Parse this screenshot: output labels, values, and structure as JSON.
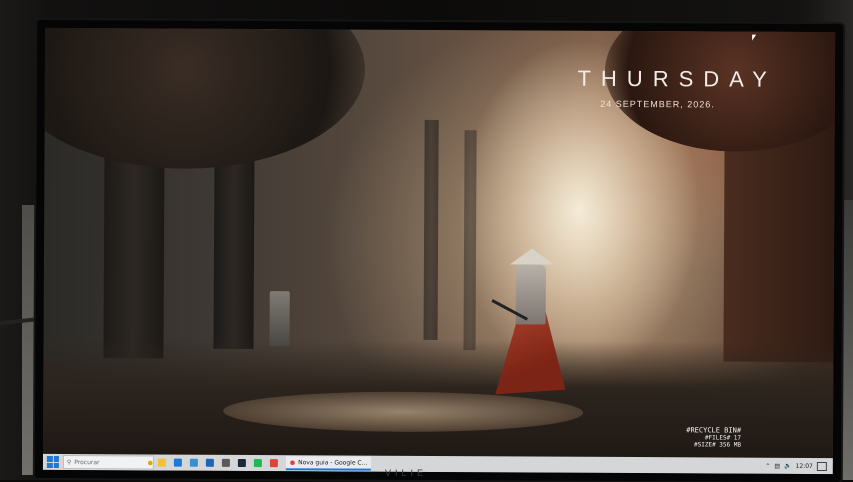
{
  "desktop": {
    "clock": {
      "day": "THURSDAY",
      "date": "24 SEPTEMBER, 2026."
    },
    "recycle_bin": {
      "title": "#RECYCLE BIN#",
      "files": "#FILES# 17",
      "size": "#SIZE# 356 MB"
    }
  },
  "taskbar": {
    "search_placeholder": "Procurar",
    "active_app": "Nova guia - Google C...",
    "time": "12:07",
    "pinned_icons": [
      "file-explorer-icon",
      "edge-icon",
      "store-icon",
      "mail-icon",
      "photos-icon",
      "steam-icon",
      "spotify-icon",
      "chrome-icon"
    ],
    "icon_colors": [
      "#f2c03a",
      "#1e78d7",
      "#3b8fd1",
      "#1e66b4",
      "#5a5a5a",
      "#1b2838",
      "#1db954",
      "#db4437"
    ]
  },
  "monitor": {
    "brand": "VILIE"
  }
}
